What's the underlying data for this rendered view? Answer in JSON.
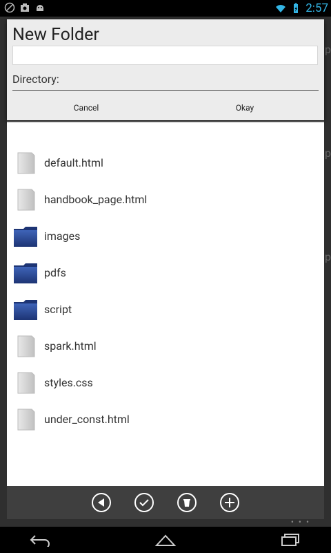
{
  "status_bar": {
    "time": "2:57",
    "icons": [
      "notification-icon",
      "camera-icon",
      "android-icon",
      "wifi-icon",
      "battery-icon"
    ]
  },
  "dialog": {
    "title": "New Folder",
    "name_value": "",
    "directory_label": "Directory:",
    "cancel_label": "Cancel",
    "okay_label": "Okay"
  },
  "files": [
    {
      "name": "default.html",
      "type": "file"
    },
    {
      "name": "handbook_page.html",
      "type": "file"
    },
    {
      "name": "images",
      "type": "folder"
    },
    {
      "name": "pdfs",
      "type": "folder"
    },
    {
      "name": "script",
      "type": "folder"
    },
    {
      "name": "spark.html",
      "type": "file"
    },
    {
      "name": "styles.css",
      "type": "file"
    },
    {
      "name": "under_const.html",
      "type": "file"
    }
  ],
  "toolbar": {
    "buttons": [
      "back-icon",
      "check-icon",
      "trash-icon",
      "add-icon"
    ]
  },
  "colors": {
    "accent": "#33b5e5",
    "folder_blue": "#2a4a94"
  }
}
